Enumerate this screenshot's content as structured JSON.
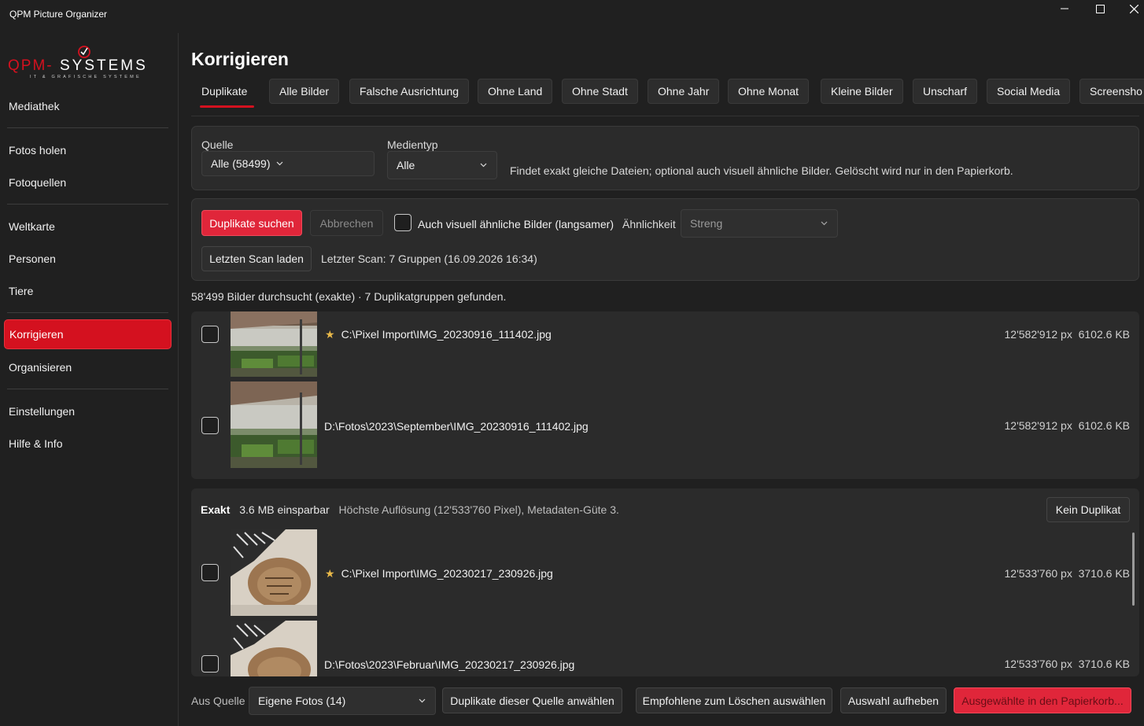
{
  "app": {
    "title": "QPM Picture Organizer"
  },
  "logo": {
    "text": "QPM-SYSTEMS",
    "tagline": "IT & GRAFISCHE SYSTEME",
    "brand_color": "#d4111f"
  },
  "sidebar": {
    "items": [
      {
        "label": "Mediathek"
      },
      {
        "label": "Fotos holen"
      },
      {
        "label": "Fotoquellen"
      },
      {
        "label": "Weltkarte"
      },
      {
        "label": "Personen"
      },
      {
        "label": "Tiere"
      },
      {
        "label": "Korrigieren",
        "active": true
      },
      {
        "label": "Organisieren"
      },
      {
        "label": "Einstellungen"
      },
      {
        "label": "Hilfe & Info"
      }
    ]
  },
  "page": {
    "title": "Korrigieren"
  },
  "tabs": [
    {
      "label": "Duplikate",
      "active": true
    },
    {
      "label": "Alle Bilder"
    },
    {
      "label": "Falsche Ausrichtung"
    },
    {
      "label": "Ohne Land"
    },
    {
      "label": "Ohne Stadt"
    },
    {
      "label": "Ohne Jahr"
    },
    {
      "label": "Ohne Monat"
    },
    {
      "label": "Kleine Bilder"
    },
    {
      "label": "Unscharf"
    },
    {
      "label": "Social Media"
    },
    {
      "label": "Screensho"
    }
  ],
  "filters": {
    "source_label": "Quelle",
    "source_value": "Alle (58499)",
    "mediatype_label": "Medientyp",
    "mediatype_value": "Alle",
    "description": "Findet exakt gleiche Dateien; optional auch visuell ähnliche Bilder. Gelöscht wird nur in den Papierkorb."
  },
  "scan": {
    "search_button": "Duplikate suchen",
    "cancel_button": "Abbrechen",
    "similar_checkbox_label": "Auch visuell ähnliche Bilder (langsamer)",
    "similar_checked": false,
    "similarity_label": "Ähnlichkeit",
    "similarity_value": "Streng",
    "load_last_button": "Letzten Scan laden",
    "last_scan_text": "Letzter Scan: 7 Gruppen (16.09.2026 16:34)"
  },
  "status": {
    "text": "58'499 Bilder durchsucht (exakte) · 7 Duplikatgruppen gefunden."
  },
  "groups": [
    {
      "rows": [
        {
          "starred": true,
          "path": "C:\\Pixel Import\\IMG_20230916_111402.jpg",
          "resolution": "12'582'912 px",
          "size": "6102.6 KB",
          "checked": false
        },
        {
          "starred": false,
          "path": "D:\\Fotos\\2023\\September\\IMG_20230916_111402.jpg",
          "resolution": "12'582'912 px",
          "size": "6102.6 KB",
          "checked": false
        }
      ]
    },
    {
      "kind": "Exakt",
      "savings": "3.6 MB einsparbar",
      "info": "Höchste Auflösung (12'533'760 Pixel), Metadaten-Güte 3.",
      "not_duplicate_button": "Kein Duplikat",
      "rows": [
        {
          "starred": true,
          "path": "C:\\Pixel Import\\IMG_20230217_230926.jpg",
          "resolution": "12'533'760 px",
          "size": "3710.6 KB",
          "checked": false
        },
        {
          "starred": false,
          "path": "D:\\Fotos\\2023\\Februar\\IMG_20230217_230926.jpg",
          "resolution": "12'533'760 px",
          "size": "3710.6 KB",
          "checked": false
        }
      ]
    }
  ],
  "bottom": {
    "from_source_label": "Aus Quelle",
    "source_value": "Eigene Fotos (14)",
    "select_source_button": "Duplikate dieser Quelle anwählen",
    "select_recommended_button": "Empfohlene zum Löschen auswählen",
    "clear_selection_button": "Auswahl aufheben",
    "trash_button": "Ausgewählte in den Papierkorb..."
  },
  "colors": {
    "accent": "#d4111f",
    "primary_button": "#e0263a",
    "background": "#202020",
    "panel": "#2b2b2b",
    "star": "#e9b949"
  }
}
